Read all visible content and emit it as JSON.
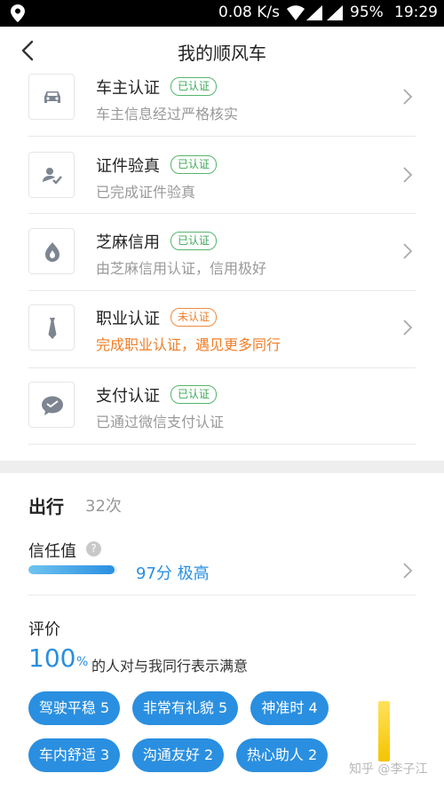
{
  "status_bar": {
    "speed": "0.08 K/s",
    "battery": "95%",
    "time": "19:29"
  },
  "nav": {
    "title": "我的顺风车"
  },
  "verifications": [
    {
      "name": "车主认证",
      "badge": "已认证",
      "desc": "车主信息经过严格核实",
      "verified": true,
      "icon": "car-icon"
    },
    {
      "name": "证件验真",
      "badge": "已认证",
      "desc": "已完成证件验真",
      "verified": true,
      "icon": "id-check-icon"
    },
    {
      "name": "芝麻信用",
      "badge": "已认证",
      "desc": "由芝麻信用认证，信用极好",
      "verified": true,
      "icon": "sesame-icon"
    },
    {
      "name": "职业认证",
      "badge": "未认证",
      "desc": "完成职业认证，遇见更多同行",
      "verified": false,
      "icon": "tie-icon"
    },
    {
      "name": "支付认证",
      "badge": "已认证",
      "desc": "已通过微信支付认证",
      "verified": true,
      "icon": "wechat-pay-icon"
    }
  ],
  "trip": {
    "title": "出行",
    "count": "32次"
  },
  "trust": {
    "label": "信任值",
    "help": "?",
    "value": "97分 极高",
    "level": 0.97
  },
  "evaluation": {
    "label": "评价",
    "percent": "100",
    "percent_unit": "%",
    "text": "的人对与我同行表示满意",
    "tags": [
      "驾驶平稳 5",
      "非常有礼貌 5",
      "神准时 4",
      "车内舒适 3",
      "沟通友好 2",
      "热心助人 2"
    ]
  },
  "watermark": "知乎 @李子江",
  "colors": {
    "accent": "#2a8fe0",
    "verified": "#3da95a",
    "unverified": "#ef7d26"
  }
}
